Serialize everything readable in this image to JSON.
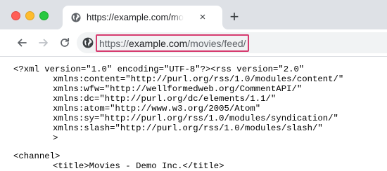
{
  "browser": {
    "tab": {
      "title": "https://example.com/movies/feed/",
      "close_glyph": "×"
    },
    "new_tab_glyph": "+",
    "address_bar": {
      "scheme_prefix": "https://",
      "domain": "example.com",
      "path": "/movies/feed/",
      "highlight_color": "#d63b6f"
    },
    "icons": {
      "tab_favicon": "globe-icon",
      "back": "arrow-left-icon",
      "forward": "arrow-right-icon",
      "reload": "reload-icon",
      "site_info": "globe-icon"
    }
  },
  "feed_source": {
    "lines": [
      "<?xml version=\"1.0\" encoding=\"UTF-8\"?><rss version=\"2.0\"",
      "xmlns:content=\"http://purl.org/rss/1.0/modules/content/\"",
      "xmlns:wfw=\"http://wellformedweb.org/CommentAPI/\"",
      "xmlns:dc=\"http://purl.org/dc/elements/1.1/\"",
      "xmlns:atom=\"http://www.w3.org/2005/Atom\"",
      "xmlns:sy=\"http://purl.org/rss/1.0/modules/syndication/\"",
      "xmlns:slash=\"http://purl.org/rss/1.0/modules/slash/\"",
      ">",
      "<channel>",
      "<title>Movies - Demo Inc.</title>"
    ]
  }
}
